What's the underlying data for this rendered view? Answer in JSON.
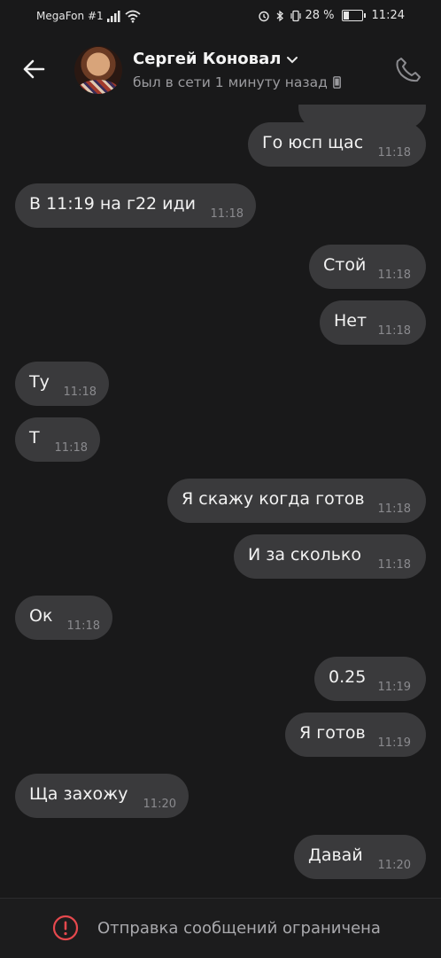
{
  "status_bar": {
    "carrier": "MegaFon #1",
    "battery": "28 %",
    "battery_level": 0.28,
    "time": "11:24"
  },
  "header": {
    "contact_name": "Сергей Коновал",
    "presence": "был в сети 1 минуту назад",
    "icons": [
      "back-arrow-icon",
      "chevron-down-icon",
      "phone-device-icon",
      "call-icon"
    ]
  },
  "messages": [
    {
      "dir": "out",
      "text": "",
      "time": ""
    },
    {
      "dir": "out",
      "text": "Го юсп щас",
      "time": "11:18"
    },
    {
      "dir": "in",
      "text": "В 11:19 на г22 иди",
      "time": "11:18"
    },
    {
      "dir": "out",
      "text": "Стой",
      "time": "11:18"
    },
    {
      "dir": "out",
      "text": "Нет",
      "time": "11:18"
    },
    {
      "dir": "in",
      "text": "Ту",
      "time": "11:18"
    },
    {
      "dir": "in",
      "text": "Т",
      "time": "11:18"
    },
    {
      "dir": "out",
      "text": "Я скажу когда готов",
      "time": "11:18"
    },
    {
      "dir": "out",
      "text": "И за сколько",
      "time": "11:18"
    },
    {
      "dir": "in",
      "text": "Ок",
      "time": "11:18"
    },
    {
      "dir": "out",
      "text": "0.25",
      "time": "11:19"
    },
    {
      "dir": "out",
      "text": "Я готов",
      "time": "11:19"
    },
    {
      "dir": "in",
      "text": "Ща захожу",
      "time": "11:20"
    },
    {
      "dir": "out",
      "text": "Давай",
      "time": "11:20"
    }
  ],
  "footer": {
    "notice": "Отправка сообщений ограничена",
    "icon": "warning-circle-icon"
  },
  "colors": {
    "background": "#19191a",
    "bubble": "#3a3a3c",
    "warning": "#e5484d"
  }
}
